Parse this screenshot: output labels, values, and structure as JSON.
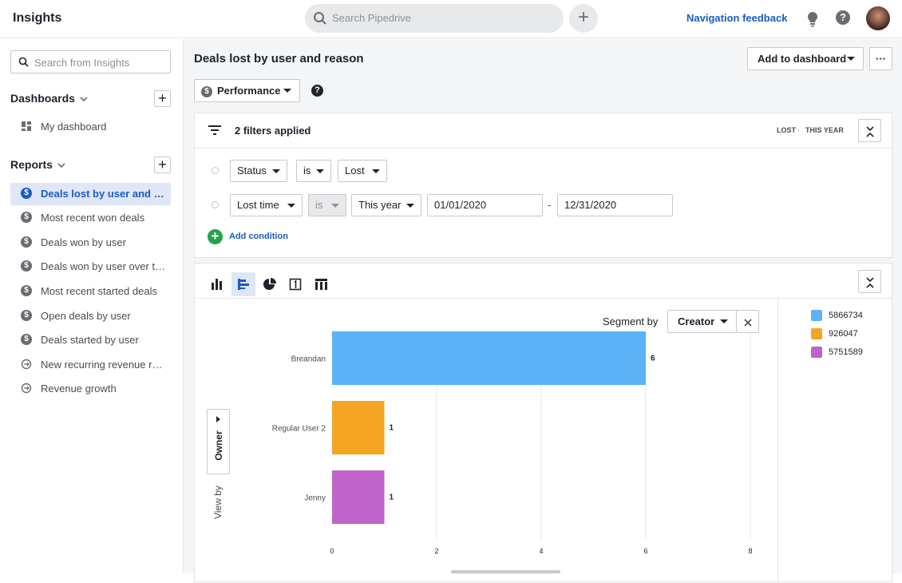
{
  "topbar": {
    "title": "Insights",
    "search_placeholder": "Search Pipedrive",
    "nav_feedback": "Navigation feedback"
  },
  "sidebar": {
    "search_placeholder": "Search from Insights",
    "dashboards_label": "Dashboards",
    "dashboards": [
      {
        "label": "My dashboard"
      }
    ],
    "reports_label": "Reports",
    "reports": [
      {
        "label": "Deals lost by user and reason",
        "icon": "dollar-icon",
        "active": true
      },
      {
        "label": "Most recent won deals",
        "icon": "dollar-icon"
      },
      {
        "label": "Deals won by user",
        "icon": "dollar-icon"
      },
      {
        "label": "Deals won by user over time",
        "icon": "dollar-icon"
      },
      {
        "label": "Most recent started deals",
        "icon": "dollar-icon"
      },
      {
        "label": "Open deals by user",
        "icon": "dollar-icon"
      },
      {
        "label": "Deals started by user",
        "icon": "dollar-icon"
      },
      {
        "label": "New recurring revenue report",
        "icon": "recurring-revenue-icon"
      },
      {
        "label": "Revenue growth",
        "icon": "recurring-revenue-icon"
      }
    ]
  },
  "report": {
    "title": "Deals lost by user and reason",
    "add_to_dashboard": "Add to dashboard",
    "more": "···",
    "type_label": "Performance"
  },
  "filters": {
    "summary": "2 filters applied",
    "status_tag": "LOST",
    "period_tag": "THIS YEAR",
    "row1": {
      "field": "Status",
      "op": "is",
      "value": "Lost"
    },
    "row2": {
      "field": "Lost time",
      "op": "is",
      "value": "This year",
      "from": "01/01/2020",
      "to": "12/31/2020",
      "dash": "-"
    },
    "add_condition": "Add condition"
  },
  "chart_controls": {
    "segment_by_label": "Segment by",
    "segment_by_value": "Creator",
    "view_by_label": "View by",
    "view_by_value": "Owner"
  },
  "chart_data": {
    "type": "bar",
    "orientation": "horizontal",
    "categories": [
      "Breandan",
      "Regular User 2",
      "Jenny"
    ],
    "values": [
      6,
      1,
      1
    ],
    "colors": [
      "#5cb2f6",
      "#f5a524",
      "#c063c8"
    ],
    "xlim": [
      0,
      8
    ],
    "xticks": [
      0,
      2,
      4,
      6,
      8
    ],
    "grid": true,
    "legend": [
      {
        "name": "5866734",
        "color": "#5cb2f6"
      },
      {
        "name": "926047",
        "color": "#f5a524"
      },
      {
        "name": "5751589",
        "color": "#c063c8"
      }
    ],
    "legend_position": "right"
  }
}
